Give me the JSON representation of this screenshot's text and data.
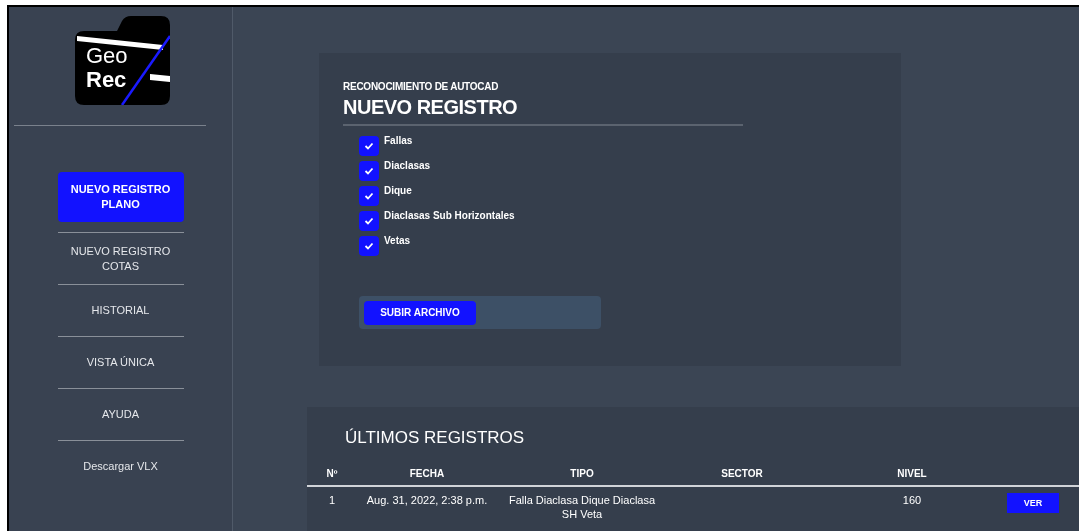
{
  "logo": {
    "line_1": "Geo",
    "line_2": "Rec"
  },
  "sidebar": {
    "items": [
      {
        "label": "NUEVO REGISTRO PLANO",
        "selected": true
      },
      {
        "label": "NUEVO REGISTRO COTAS",
        "selected": false
      },
      {
        "label": "HISTORIAL",
        "selected": false
      },
      {
        "label": "VISTA ÚNICA",
        "selected": false
      },
      {
        "label": "AYUDA",
        "selected": false
      },
      {
        "label": "Descargar VLX",
        "selected": false
      }
    ]
  },
  "form": {
    "subtitle": "RECONOCIMIENTO DE AUTOCAD",
    "title": "NUEVO REGISTRO",
    "options": [
      {
        "label": "Fallas",
        "checked": true
      },
      {
        "label": "Diaclasas",
        "checked": true
      },
      {
        "label": "Dique",
        "checked": true
      },
      {
        "label": "Diaclasas Sub Horizontales",
        "checked": true
      },
      {
        "label": "Vetas",
        "checked": true
      }
    ],
    "upload_button": "SUBIR ARCHIVO"
  },
  "table": {
    "title": "ÚLTIMOS REGISTROS",
    "columns": [
      "Nº",
      "FECHA",
      "TIPO",
      "SECTOR",
      "NIVEL"
    ],
    "rows": [
      {
        "cells": [
          "1",
          "Aug. 31, 2022, 2:38 p.m.",
          "Falla Diaclasa Dique Diaclasa SH Veta",
          "",
          "160"
        ],
        "action": "VER"
      }
    ]
  }
}
